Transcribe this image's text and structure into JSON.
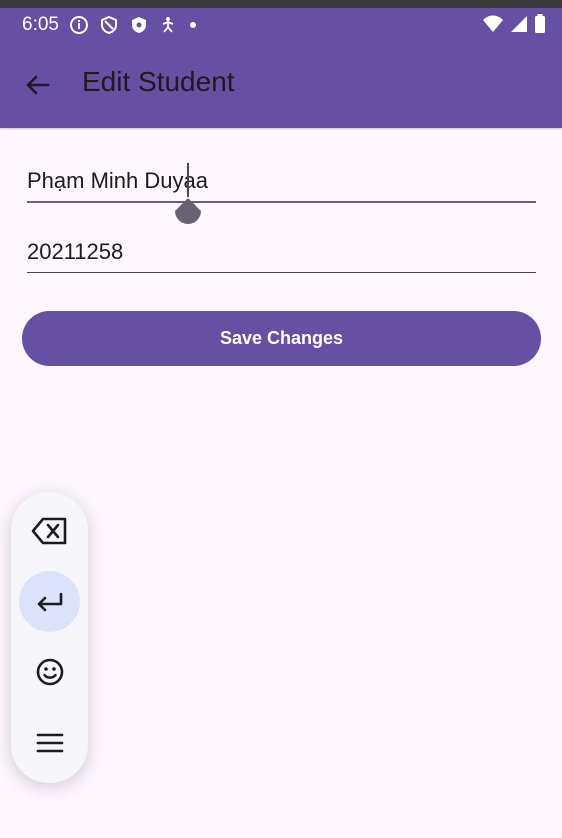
{
  "status_bar": {
    "time": "6:05",
    "icons_left": [
      "info-icon",
      "shield-icon",
      "shield-check-icon",
      "accessibility-icon",
      "dot-icon"
    ],
    "icons_right": [
      "wifi-icon",
      "signal-icon",
      "battery-icon"
    ]
  },
  "app_bar": {
    "title": "Edit Student",
    "back_icon": "arrow-back-icon"
  },
  "form": {
    "name_value": "Phạm Minh Duyaa",
    "student_id_value": "20211258",
    "save_label": "Save Changes"
  },
  "keyboard_toolbar": {
    "buttons": [
      "backspace-icon",
      "enter-icon",
      "emoji-icon",
      "menu-icon"
    ],
    "active": "enter-icon"
  },
  "colors": {
    "primary": "#674FA3",
    "background": "#FEF7FF",
    "toolbar_bg": "#F7F7FB",
    "active_highlight": "#DCE2F9"
  }
}
